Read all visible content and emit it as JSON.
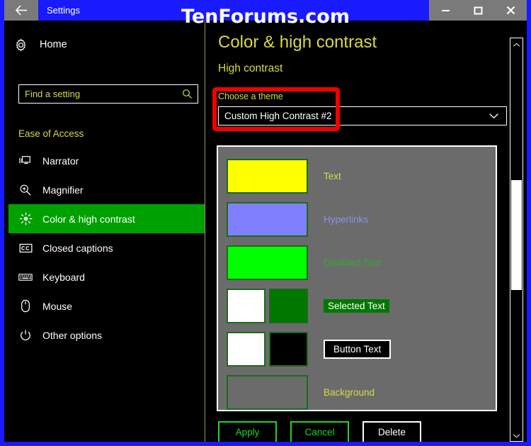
{
  "window": {
    "title": "Settings",
    "back_icon": "back-arrow-icon",
    "minimize_label": "–",
    "maximize_label": "□",
    "close_label": "×",
    "accent_color": "#1a1aff",
    "titlebar_button_bg": "#7a7a7a"
  },
  "watermark": {
    "text": "TenForums.com"
  },
  "sidebar": {
    "home": {
      "label": "Home",
      "icon": "gear-icon"
    },
    "search": {
      "placeholder": "Find a setting",
      "value": "",
      "icon": "search-icon"
    },
    "section_label": "Ease of Access",
    "items": [
      {
        "label": "Narrator",
        "icon": "narrator-icon",
        "selected": false
      },
      {
        "label": "Magnifier",
        "icon": "magnifier-icon",
        "selected": false
      },
      {
        "label": "Color & high contrast",
        "icon": "brightness-icon",
        "selected": true
      },
      {
        "label": "Closed captions",
        "icon": "closed-captions-icon",
        "selected": false
      },
      {
        "label": "Keyboard",
        "icon": "keyboard-icon",
        "selected": false
      },
      {
        "label": "Mouse",
        "icon": "mouse-icon",
        "selected": false
      },
      {
        "label": "Other options",
        "icon": "power-options-icon",
        "selected": false
      }
    ],
    "selected_bg": "#00a000"
  },
  "main": {
    "page_title": "Color & high contrast",
    "subheading": "High contrast",
    "choose_theme_label": "Choose a theme",
    "theme_dropdown": {
      "value": "Custom High Contrast #2",
      "chevron_icon": "chevron-down-icon"
    },
    "preview": {
      "background_color": "#6b6b6b",
      "swatch_border_color": "#1c6b1c",
      "rows": [
        {
          "label": "Text",
          "label_style": "text",
          "swatches": [
            {
              "color": "#ffff00",
              "shape": "wide"
            }
          ]
        },
        {
          "label": "Hyperlinks",
          "label_style": "hyper",
          "swatches": [
            {
              "color": "#8080ff",
              "shape": "wide"
            }
          ]
        },
        {
          "label": "Disabled Text",
          "label_style": "disabled",
          "swatches": [
            {
              "color": "#00ff00",
              "shape": "wide"
            }
          ]
        },
        {
          "label": "Selected Text",
          "label_style": "selected",
          "swatches": [
            {
              "color": "#ffffff",
              "shape": "square"
            },
            {
              "color": "#007800",
              "shape": "square"
            }
          ]
        },
        {
          "label": "Button Text",
          "label_style": "button",
          "swatches": [
            {
              "color": "#ffffff",
              "shape": "square"
            },
            {
              "color": "#000000",
              "shape": "square"
            }
          ]
        },
        {
          "label": "Background",
          "label_style": "bg",
          "swatches": [
            {
              "color": "#6b6b6b",
              "shape": "wide"
            }
          ]
        }
      ]
    },
    "buttons": [
      {
        "label": "Apply",
        "style": "green"
      },
      {
        "label": "Cancel",
        "style": "green"
      },
      {
        "label": "Delete",
        "style": "white"
      }
    ]
  },
  "scrollbar": {
    "up_icon": "chevron-up-icon",
    "down_icon": "chevron-down-icon",
    "thumb_color": "#ffffff"
  },
  "annotation": {
    "color": "#f00000",
    "target": "choose-a-theme-dropdown"
  }
}
